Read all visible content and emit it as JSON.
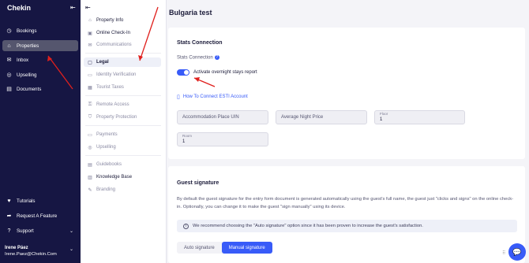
{
  "app": {
    "logo": "Chekin",
    "collapse_icon": "collapse-left-icon"
  },
  "sidebar": {
    "items": [
      {
        "label": "Bookings",
        "icon": "calendar-icon",
        "glyph": "◷"
      },
      {
        "label": "Properties",
        "icon": "home-icon",
        "glyph": "⌂"
      },
      {
        "label": "Inbox",
        "icon": "inbox-icon",
        "glyph": "✉"
      },
      {
        "label": "Upselling",
        "icon": "upselling-icon",
        "glyph": "◎"
      },
      {
        "label": "Documents",
        "icon": "document-icon",
        "glyph": "▤"
      }
    ],
    "bottom": [
      {
        "label": "Tutorials",
        "glyph": "♥"
      },
      {
        "label": "Request A Feature",
        "glyph": "➦"
      },
      {
        "label": "Support",
        "glyph": "?"
      }
    ],
    "user": {
      "name": "Irene Páez",
      "email": "Irene.Paez@Chekin.Com"
    }
  },
  "subnav": {
    "group1": [
      "Property Info",
      "Online Check-In",
      "Communications"
    ],
    "group2": [
      "Legal",
      "Identity Verification",
      "Tourist Taxes"
    ],
    "group3": [
      "Remote Access",
      "Property Protection"
    ],
    "group4": [
      "Payments",
      "Upselling"
    ],
    "group5": [
      "Guidebooks",
      "Knowledge Base",
      "Branding"
    ]
  },
  "page": {
    "title": "Bulgaria test"
  },
  "stats": {
    "title": "Stats Connection",
    "label": "Stats Connection",
    "toggle_label": "Activate overnight stays report",
    "link": "How To Connect ESTI Account",
    "fields": {
      "accommodation_placeholder": "Accommodation Place UIN",
      "price_placeholder": "Average Night Price",
      "floor_label": "Floor",
      "floor_value": "1",
      "room_label": "Room",
      "room_value": "1"
    }
  },
  "signature": {
    "title": "Guest signature",
    "description": "By default the guest signature for the entry form document is generated automatically using the guest's full name, the guest just \"clicks and signs\" on the online check-in. Optionally, you can change it to make the guest \"sign manually\" using its device.",
    "notice": "We recommend choosing the \"Auto signature\" option since it has been proven to increase the guest's satisfaction.",
    "options": [
      "Auto signature",
      "Manual signature"
    ],
    "selected": "Manual signature"
  },
  "colors": {
    "sidebar": "#161643",
    "accent": "#385bf8",
    "annotation": "#e0201d"
  }
}
